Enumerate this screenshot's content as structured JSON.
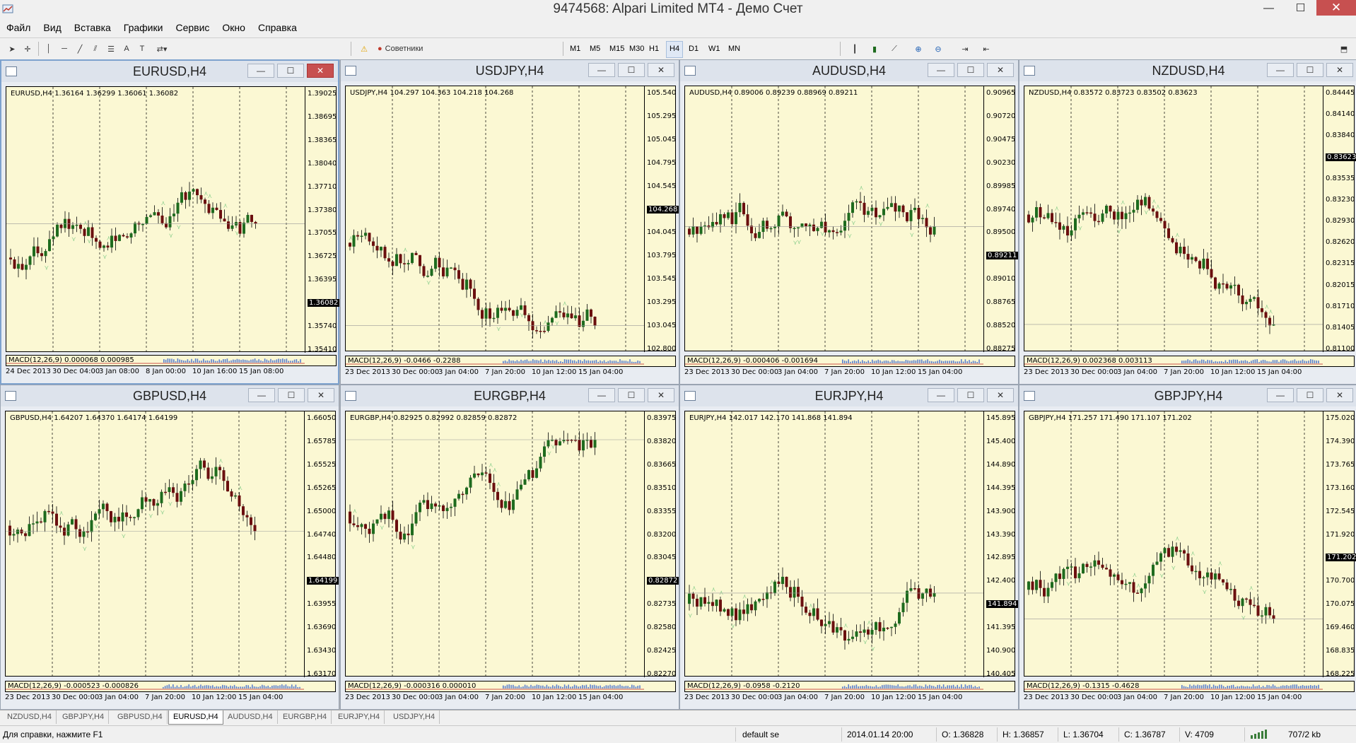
{
  "window": {
    "title": "9474568: Alpari Limited MT4 - Демо Счет"
  },
  "menu": [
    "Файл",
    "Вид",
    "Вставка",
    "Графики",
    "Сервис",
    "Окно",
    "Справка"
  ],
  "toolbar": {
    "advisors_label": "Советники",
    "timeframes": [
      "M1",
      "M5",
      "M15",
      "M30",
      "H1",
      "H4",
      "D1",
      "W1",
      "MN"
    ],
    "active_timeframe": "H4"
  },
  "charts": [
    {
      "title": "EURUSD,H4",
      "info": "EURUSD,H4  1.36164 1.36299 1.36061 1.36082",
      "prices": [
        "1.39025",
        "1.38695",
        "1.38365",
        "1.38040",
        "1.37710",
        "1.37380",
        "1.37055",
        "1.36725",
        "1.36395",
        "1.36082",
        "1.35740",
        "1.35410"
      ],
      "current": "1.36082",
      "macd": "MACD(12,26,9) 0.000068 0.000985",
      "times": [
        "24 Dec 2013",
        "30 Dec 04:00",
        "3 Jan 08:00",
        "8 Jan 00:00",
        "10 Jan 16:00",
        "15 Jan 08:00"
      ],
      "active": true
    },
    {
      "title": "USDJPY,H4",
      "info": "USDJPY,H4  104.297 104.363 104.218 104.268",
      "prices": [
        "105.540",
        "105.295",
        "105.045",
        "104.795",
        "104.545",
        "104.268",
        "104.045",
        "103.795",
        "103.545",
        "103.295",
        "103.045",
        "102.800"
      ],
      "current": "104.268",
      "macd": "MACD(12,26,9) -0.0466 -0.2288",
      "times": [
        "23 Dec 2013",
        "30 Dec 00:00",
        "3 Jan 04:00",
        "7 Jan 20:00",
        "10 Jan 12:00",
        "15 Jan 04:00"
      ],
      "active": false
    },
    {
      "title": "AUDUSD,H4",
      "info": "AUDUSD,H4  0.89006 0.89239 0.88969 0.89211",
      "prices": [
        "0.90965",
        "0.90720",
        "0.90475",
        "0.90230",
        "0.89985",
        "0.89740",
        "0.89500",
        "0.89211",
        "0.89010",
        "0.88765",
        "0.88520",
        "0.88275"
      ],
      "current": "0.89211",
      "macd": "MACD(12,26,9) -0.000406 -0.001694",
      "times": [
        "23 Dec 2013",
        "30 Dec 00:00",
        "3 Jan 04:00",
        "7 Jan 20:00",
        "10 Jan 12:00",
        "15 Jan 04:00"
      ],
      "active": false
    },
    {
      "title": "NZDUSD,H4",
      "info": "NZDUSD,H4  0.83572 0.83723 0.83502 0.83623",
      "prices": [
        "0.84445",
        "0.84140",
        "0.83840",
        "0.83623",
        "0.83535",
        "0.83230",
        "0.82930",
        "0.82620",
        "0.82315",
        "0.82015",
        "0.81710",
        "0.81405",
        "0.81100"
      ],
      "current": "0.83623",
      "macd": "MACD(12,26,9) 0.002368 0.003113",
      "times": [
        "23 Dec 2013",
        "30 Dec 00:00",
        "3 Jan 04:00",
        "7 Jan 20:00",
        "10 Jan 12:00",
        "15 Jan 04:00"
      ],
      "active": false
    },
    {
      "title": "GBPUSD,H4",
      "info": "GBPUSD,H4  1.64207 1.64370 1.64174 1.64199",
      "prices": [
        "1.66050",
        "1.65785",
        "1.65525",
        "1.65265",
        "1.65000",
        "1.64740",
        "1.64480",
        "1.64199",
        "1.63955",
        "1.63690",
        "1.63430",
        "1.63170"
      ],
      "current": "1.64199",
      "macd": "MACD(12,26,9) -0.000523 -0.000826",
      "times": [
        "23 Dec 2013",
        "30 Dec 00:00",
        "3 Jan 04:00",
        "7 Jan 20:00",
        "10 Jan 12:00",
        "15 Jan 04:00"
      ],
      "active": false
    },
    {
      "title": "EURGBP,H4",
      "info": "EURGBP,H4  0.82925 0.82992 0.82859 0.82872",
      "prices": [
        "0.83975",
        "0.83820",
        "0.83665",
        "0.83510",
        "0.83355",
        "0.83200",
        "0.83045",
        "0.82872",
        "0.82735",
        "0.82580",
        "0.82425",
        "0.82270"
      ],
      "current": "0.82872",
      "macd": "MACD(12,26,9) -0.000316 0.000010",
      "times": [
        "23 Dec 2013",
        "30 Dec 00:00",
        "3 Jan 04:00",
        "7 Jan 20:00",
        "10 Jan 12:00",
        "15 Jan 04:00"
      ],
      "active": false
    },
    {
      "title": "EURJPY,H4",
      "info": "EURJPY,H4  142.017 142.170 141.868 141.894",
      "prices": [
        "145.895",
        "145.400",
        "144.890",
        "144.395",
        "143.900",
        "143.390",
        "142.895",
        "142.400",
        "141.894",
        "141.395",
        "140.900",
        "140.405"
      ],
      "current": "141.894",
      "macd": "MACD(12,26,9) -0.0958 -0.2120",
      "times": [
        "23 Dec 2013",
        "30 Dec 00:00",
        "3 Jan 04:00",
        "7 Jan 20:00",
        "10 Jan 12:00",
        "15 Jan 04:00"
      ],
      "active": false
    },
    {
      "title": "GBPJPY,H4",
      "info": "GBPJPY,H4  171.257 171.490 171.107 171.202",
      "prices": [
        "175.020",
        "174.390",
        "173.765",
        "173.160",
        "172.545",
        "171.920",
        "171.202",
        "170.700",
        "170.075",
        "169.460",
        "168.835",
        "168.225"
      ],
      "current": "171.202",
      "macd": "MACD(12,26,9) -0.1315 -0.4628",
      "times": [
        "23 Dec 2013",
        "30 Dec 00:00",
        "3 Jan 04:00",
        "7 Jan 20:00",
        "10 Jan 12:00",
        "15 Jan 04:00"
      ],
      "active": false
    }
  ],
  "tabs": [
    "NZDUSD,H4",
    "GBPJPY,H4",
    "GBPUSD,H4",
    "EURUSD,H4",
    "AUDUSD,H4",
    "EURGBP,H4",
    "EURJPY,H4",
    "USDJPY,H4"
  ],
  "active_tab": "EURUSD,H4",
  "status": {
    "help": "Для справки, нажмите F1",
    "profile": "default se",
    "datetime": "2014.01.14 20:00",
    "open": "O: 1.36828",
    "high": "H: 1.36857",
    "low": "L: 1.36704",
    "close": "C: 1.36787",
    "volume": "V: 4709",
    "traffic": "707/2 kb"
  },
  "colors": {
    "chart_bg": "#fbf8d3",
    "bull": "#1e6b1e",
    "bear": "#6b0f0f",
    "fractal": "#8fd08f",
    "macd": "#5b7fcf"
  }
}
